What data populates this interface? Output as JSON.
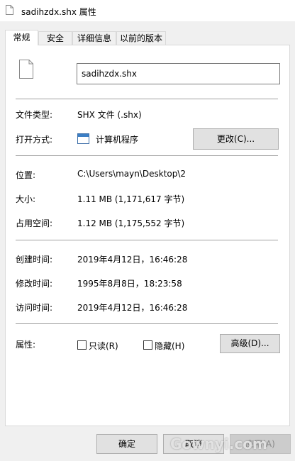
{
  "window": {
    "title": "sadihzdx.shx 属性"
  },
  "tabs": [
    {
      "label": "常规",
      "active": true
    },
    {
      "label": "安全",
      "active": false
    },
    {
      "label": "详细信息",
      "active": false
    },
    {
      "label": "以前的版本",
      "active": false
    }
  ],
  "general": {
    "filename": "sadihzdx.shx",
    "file_type": {
      "label": "文件类型:",
      "value": "SHX 文件 (.shx)"
    },
    "opens_with": {
      "label": "打开方式:",
      "value": "计算机程序",
      "change_button": "更改(C)..."
    },
    "location": {
      "label": "位置:",
      "value": "C:\\Users\\mayn\\Desktop\\2"
    },
    "size": {
      "label": "大小:",
      "value": "1.11 MB (1,171,617 字节)"
    },
    "size_on_disk": {
      "label": "占用空间:",
      "value": "1.12 MB (1,175,552 字节)"
    },
    "created": {
      "label": "创建时间:",
      "value": "2019年4月12日，16:46:28"
    },
    "modified": {
      "label": "修改时间:",
      "value": "1995年8月8日，18:23:58"
    },
    "accessed": {
      "label": "访问时间:",
      "value": "2019年4月12日，16:46:28"
    },
    "attributes": {
      "label": "属性:",
      "readonly": {
        "label": "只读(R)",
        "checked": false
      },
      "hidden": {
        "label": "隐藏(H)",
        "checked": false
      },
      "advanced_button": "高级(D)..."
    }
  },
  "footer": {
    "ok": "确定",
    "cancel": "取消",
    "apply": "应用(A)"
  },
  "watermark": "Gownyi.com"
}
